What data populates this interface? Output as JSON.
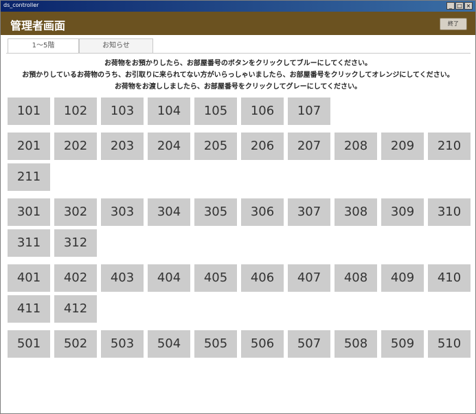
{
  "window": {
    "title": "ds_controller"
  },
  "header": {
    "title": "管理者画面",
    "close_label": "終了"
  },
  "tabs": [
    {
      "label": "1～5階"
    },
    {
      "label": "お知らせ"
    }
  ],
  "instructions": [
    "お荷物をお預かりしたら、お部屋番号のボタンをクリックしてブルーにしてください。",
    "お預かりしているお荷物のうち、お引取りに来られてない方がいらっしゃいましたら、お部屋番号をクリックしてオレンジにしてください。",
    "お荷物をお渡ししましたら、お部屋番号をクリックしてグレーにしてください。"
  ],
  "floors": [
    {
      "floor": 1,
      "rooms": [
        "101",
        "102",
        "103",
        "104",
        "105",
        "106",
        "107"
      ]
    },
    {
      "floor": 2,
      "rooms": [
        "201",
        "202",
        "203",
        "204",
        "205",
        "206",
        "207",
        "208",
        "209",
        "210",
        "211"
      ]
    },
    {
      "floor": 3,
      "rooms": [
        "301",
        "302",
        "303",
        "304",
        "305",
        "306",
        "307",
        "308",
        "309",
        "310",
        "311",
        "312"
      ]
    },
    {
      "floor": 4,
      "rooms": [
        "401",
        "402",
        "403",
        "404",
        "405",
        "406",
        "407",
        "408",
        "409",
        "410",
        "411",
        "412"
      ]
    },
    {
      "floor": 5,
      "rooms": [
        "501",
        "502",
        "503",
        "504",
        "505",
        "506",
        "507",
        "508",
        "509",
        "510"
      ]
    }
  ],
  "colors": {
    "header": "#6b5220",
    "room_default": "#cccccc"
  }
}
